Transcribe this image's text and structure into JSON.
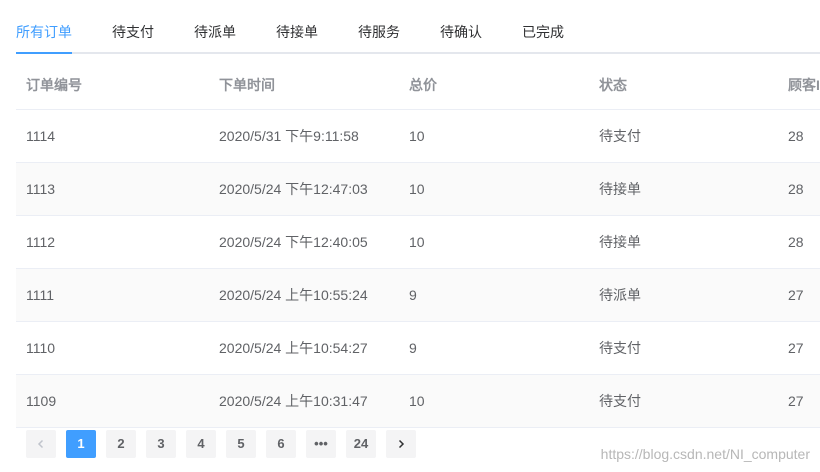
{
  "tabs": [
    {
      "label": "所有订单",
      "active": true
    },
    {
      "label": "待支付"
    },
    {
      "label": "待派单"
    },
    {
      "label": "待接单"
    },
    {
      "label": "待服务"
    },
    {
      "label": "待确认"
    },
    {
      "label": "已完成"
    }
  ],
  "table": {
    "headers": [
      "订单编号",
      "下单时间",
      "总价",
      "状态",
      "顾客I"
    ],
    "rows": [
      [
        "1114",
        "2020/5/31 下午9:11:58",
        "10",
        "待支付",
        "28"
      ],
      [
        "1113",
        "2020/5/24 下午12:47:03",
        "10",
        "待接单",
        "28"
      ],
      [
        "1112",
        "2020/5/24 下午12:40:05",
        "10",
        "待接单",
        "28"
      ],
      [
        "1111",
        "2020/5/24 上午10:55:24",
        "9",
        "待派单",
        "27"
      ],
      [
        "1110",
        "2020/5/24 上午10:54:27",
        "9",
        "待支付",
        "27"
      ],
      [
        "1109",
        "2020/5/24 上午10:31:47",
        "10",
        "待支付",
        "27"
      ]
    ]
  },
  "pagination": {
    "pages": [
      "1",
      "2",
      "3",
      "4",
      "5",
      "6",
      "•••",
      "24"
    ],
    "current_page": "1",
    "prev_icon": "chevron-left-icon",
    "next_icon": "chevron-right-icon"
  },
  "watermark": "https://blog.csdn.net/NI_computer",
  "colors": {
    "accent": "#409eff",
    "text": "#606266",
    "header_text": "#909399",
    "stripe": "#fafafa",
    "border": "#ebeef5"
  }
}
